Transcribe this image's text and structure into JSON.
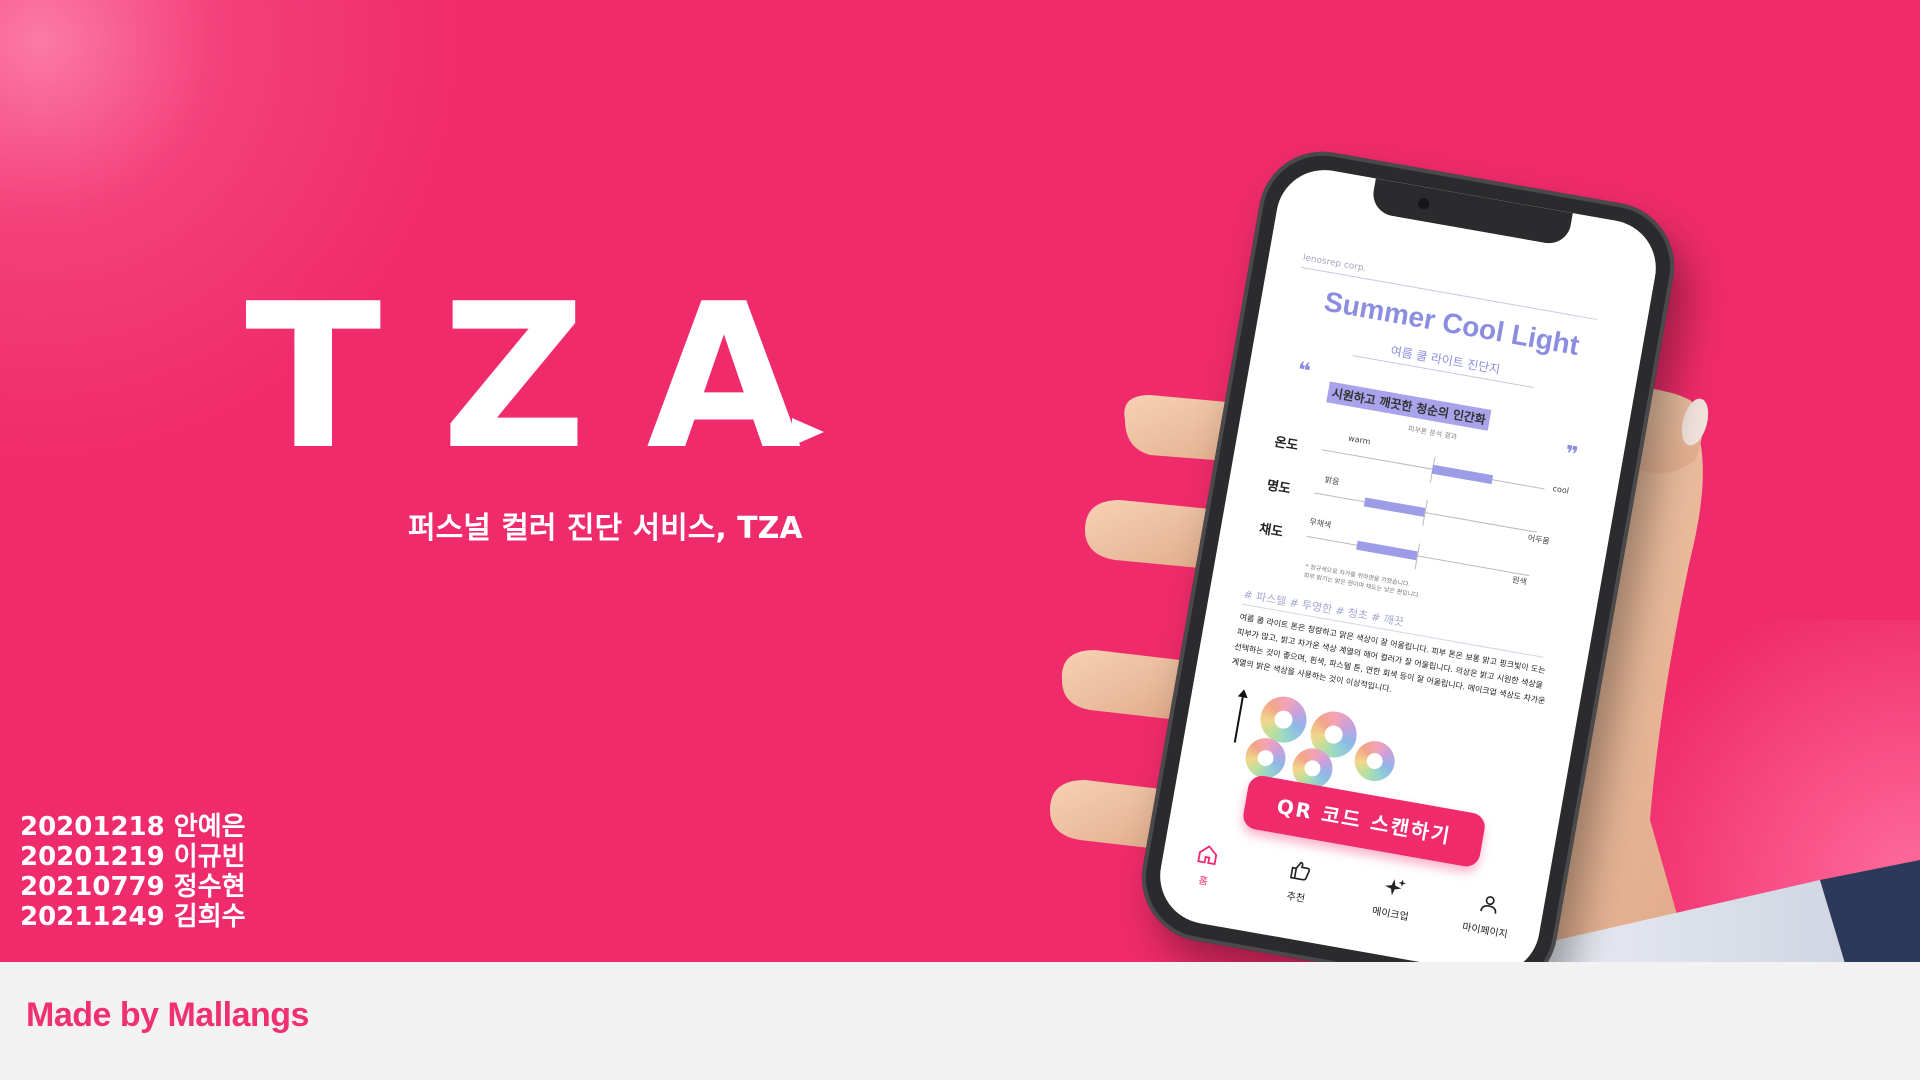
{
  "brand": {
    "logo": "TZA",
    "subtitle": "퍼스널 컬러 진단 서비스, TZA",
    "made_by": "Made by Mallangs"
  },
  "members": [
    "20201218 안예은",
    "20201219 이규빈",
    "20210779 정수현",
    "20211249 김희수"
  ],
  "colors": {
    "accent": "#f02b6b",
    "footer_bg": "#f3f2f3",
    "card_purple": "#8b8ee0",
    "bar_fill": "#9c9de6"
  },
  "phone": {
    "card": {
      "corp": "lenosrep corp.",
      "title": "Summer Cool Light",
      "subtitle": "여름 쿨 라이트 진단지",
      "quote": "시원하고 깨끗한 청순의 인간화",
      "analysis_label": "피부톤 분석 결과",
      "scales": [
        {
          "label": "온도",
          "left": "warm",
          "right": "cool",
          "value": 0.27
        },
        {
          "label": "명도",
          "left": "밝음",
          "right": "어두움",
          "value": -0.27
        },
        {
          "label": "채도",
          "left": "무채색",
          "right": "원색",
          "value": -0.27
        }
      ],
      "note": "* 정규색으로 자가를 위하면을 가졌습니다.\n피부 밝기는 밝은 편이며 채도는 낮은 편입니다.",
      "tags": "# 파스텔  # 투명한  # 청초  # 깨끗",
      "description": "여름 쿨 라이트 톤은 청량하고 맑은 색상이 잘 어울립니다. 피부 톤은 보통 밝고 핑크빛이 도는 피부가 많고, 밝고 차가운 색상 계열의 헤어 컬러가 잘 어울립니다. 의상은 밝고 시원한 색상을 선택하는 것이 좋으며, 흰색, 파스텔 톤, 연한 회색 등이 잘 어울립니다. 메이크업 색상도 차가운 계열의 밝은 색상을 사용하는 것이 이상적입니다."
    },
    "qr_button": "QR 코드 스캔하기",
    "tabs": [
      {
        "label": "홈",
        "icon": "home-icon",
        "active": true
      },
      {
        "label": "추천",
        "icon": "thumbs-up-icon",
        "active": false
      },
      {
        "label": "메이크업",
        "icon": "sparkle-icon",
        "active": false
      },
      {
        "label": "마이페이지",
        "icon": "user-icon",
        "active": false
      }
    ]
  }
}
